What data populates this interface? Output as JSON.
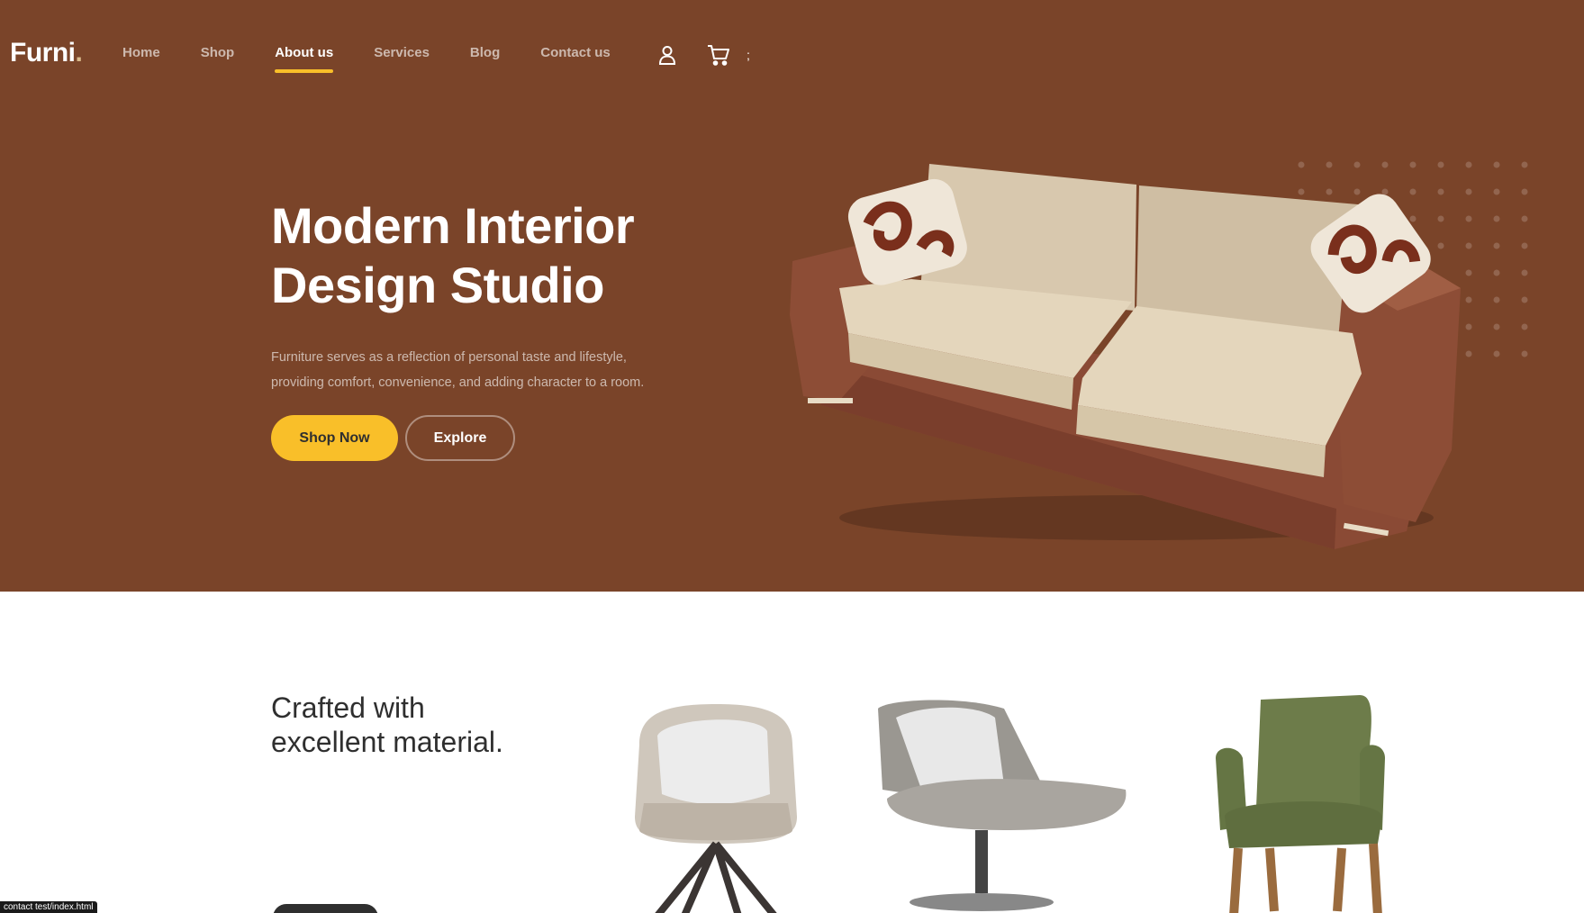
{
  "brand": {
    "name": "Furni",
    "dot": "."
  },
  "nav": {
    "items": [
      {
        "label": "Home",
        "active": false
      },
      {
        "label": "Shop",
        "active": false
      },
      {
        "label": "About us",
        "active": true
      },
      {
        "label": "Services",
        "active": false
      },
      {
        "label": "Blog",
        "active": false
      },
      {
        "label": "Contact us",
        "active": false
      }
    ],
    "separator": ";",
    "icons": [
      "user-icon",
      "cart-icon"
    ]
  },
  "hero": {
    "title_line1": "Modern Interior",
    "title_line2": "Design Studio",
    "description_line1": "Furniture serves as a reflection of personal taste and lifestyle,",
    "description_line2": "providing comfort, convenience, and adding character to a room.",
    "shop_button": "Shop Now",
    "explore_button": "Explore"
  },
  "section2": {
    "title_line1": "Crafted with",
    "title_line2": "excellent material."
  },
  "status_bar": {
    "text": "contact test/index.html"
  },
  "colors": {
    "hero_bg": "#7a4429",
    "accent": "#f9bf29",
    "dark": "#2f2f2f"
  }
}
